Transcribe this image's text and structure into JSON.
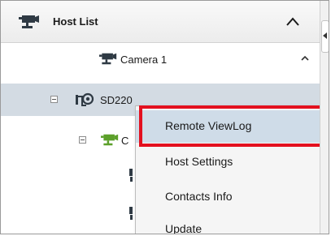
{
  "header": {
    "title": "Host List",
    "icon": "camera-icon",
    "collapse_icon": "chevron-up-icon"
  },
  "splitter": {
    "icon": "collapse-left-icon"
  },
  "tree": {
    "rows": [
      {
        "label": "Camera 1",
        "icon": "camera-icon",
        "icon_color": "#2f3a44"
      },
      {
        "label": "SD220",
        "icon": "ptz-camera-icon",
        "expander": "minus",
        "selected": true
      },
      {
        "label": "C",
        "icon": "camera-icon",
        "icon_color": "#5ca02a",
        "expander": "minus"
      }
    ]
  },
  "context_menu": {
    "items": [
      {
        "label": "Remote ViewLog",
        "highlighted": true
      },
      {
        "label": "Host Settings"
      },
      {
        "label": "Contacts Info"
      },
      {
        "label": "Update"
      }
    ]
  },
  "colors": {
    "highlight_border": "#e3101f",
    "selected_row": "#d3dbe3",
    "menu_hover": "#cfdce8",
    "online_camera": "#5ca02a"
  }
}
